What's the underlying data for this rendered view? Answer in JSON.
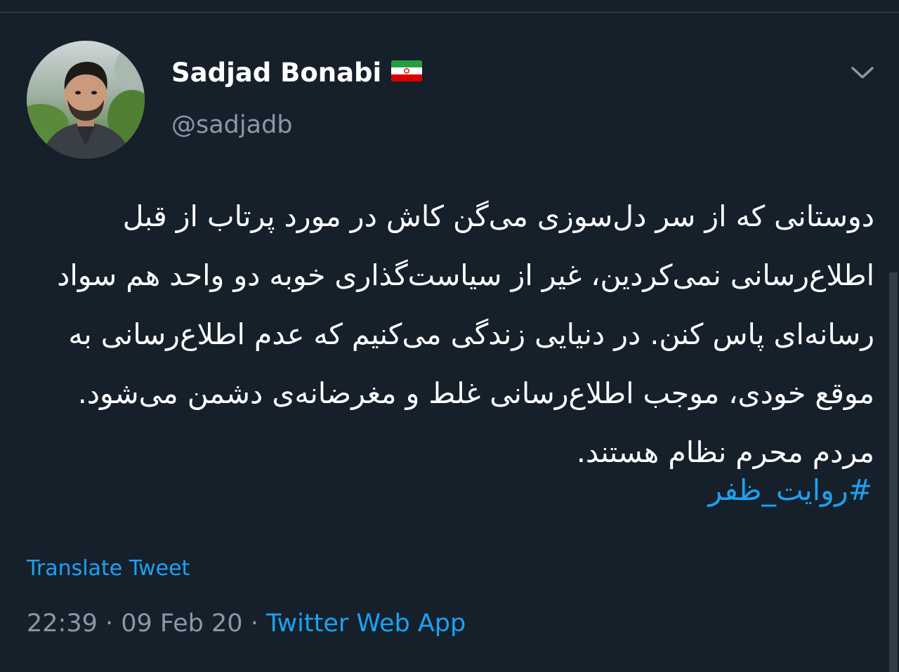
{
  "tweet": {
    "author": {
      "name": "Sadjad Bonabi",
      "flag": "iran-flag-icon",
      "handle": "@sadjadb"
    },
    "body": "دوستانی که از سر دل‌سوزی می‌گن کاش در مورد پرتاب از قبل اطلاع‌رسانی نمی‌کردین، غیر از سیاست‌گذاری خوبه دو واحد هم سواد رسانه‌ای پاس کنن. در دنیایی زندگی می‌کنیم که عدم اطلاع‌رسانی به موقع خودی، موجب اطلاع‌رسانی غلط و مغرضانه‌ی دشمن می‌شود. مردم محرم نظام هستند.",
    "hashtag": "#روایت_ظفر",
    "translate_label": "Translate Tweet",
    "meta": {
      "time": "22:39",
      "sep1": " · ",
      "date": "09 Feb 20",
      "sep2": " · ",
      "source": "Twitter Web App"
    },
    "menu_icon": "chevron-down-icon"
  },
  "colors": {
    "background": "#15202b",
    "text": "#ffffff",
    "secondary": "#8899a6",
    "accent": "#1da1f2"
  }
}
